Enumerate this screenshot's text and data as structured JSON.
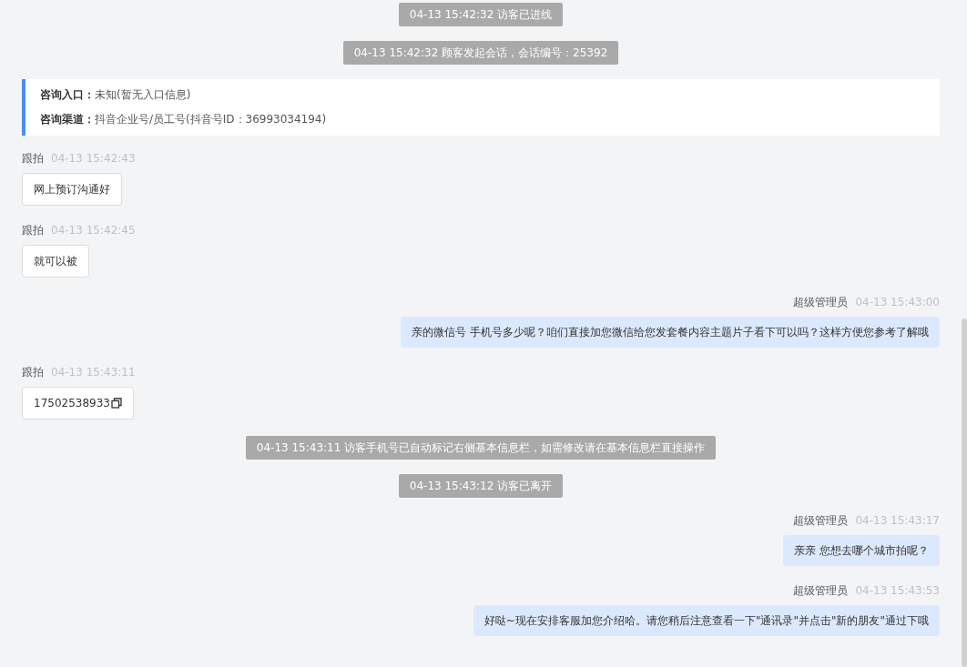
{
  "messages": [
    {
      "kind": "system",
      "text": "04-13 15:42:32 访客已进线"
    },
    {
      "kind": "system",
      "text": "04-13 15:42:32 顾客发起会话，会话编号：25392"
    },
    {
      "kind": "info",
      "rows": [
        {
          "label": "咨询入口：",
          "value": "未知(暂无入口信息)"
        },
        {
          "label": "咨询渠道：",
          "value": "抖音企业号/员工号(抖音号ID：36993034194)"
        }
      ]
    },
    {
      "kind": "incoming",
      "sender": "跟拍",
      "time": "04-13 15:42:43",
      "text": "网上预订沟通好",
      "copyable": false
    },
    {
      "kind": "incoming",
      "sender": "跟拍",
      "time": "04-13 15:42:45",
      "text": "就可以被",
      "copyable": false
    },
    {
      "kind": "outgoing",
      "sender": "超级管理员",
      "time": "04-13 15:43:00",
      "text": "亲的微信号 手机号多少呢？咱们直接加您微信给您发套餐内容主题片子看下可以吗？这样方便您参考了解哦"
    },
    {
      "kind": "incoming",
      "sender": "跟拍",
      "time": "04-13 15:43:11",
      "text": "17502538933",
      "copyable": true
    },
    {
      "kind": "system",
      "text": "04-13 15:43:11 访客手机号已自动标记右侧基本信息栏，如需修改请在基本信息栏直接操作"
    },
    {
      "kind": "system",
      "text": "04-13 15:43:12 访客已离开"
    },
    {
      "kind": "outgoing",
      "sender": "超级管理员",
      "time": "04-13 15:43:17",
      "text": "亲亲 您想去哪个城市拍呢？"
    },
    {
      "kind": "outgoing",
      "sender": "超级管理员",
      "time": "04-13 15:43:53",
      "text": "好哒~现在安排客服加您介绍哈。请您稍后注意查看一下\"通讯录\"并点击\"新的朋友\"通过下哦"
    }
  ]
}
